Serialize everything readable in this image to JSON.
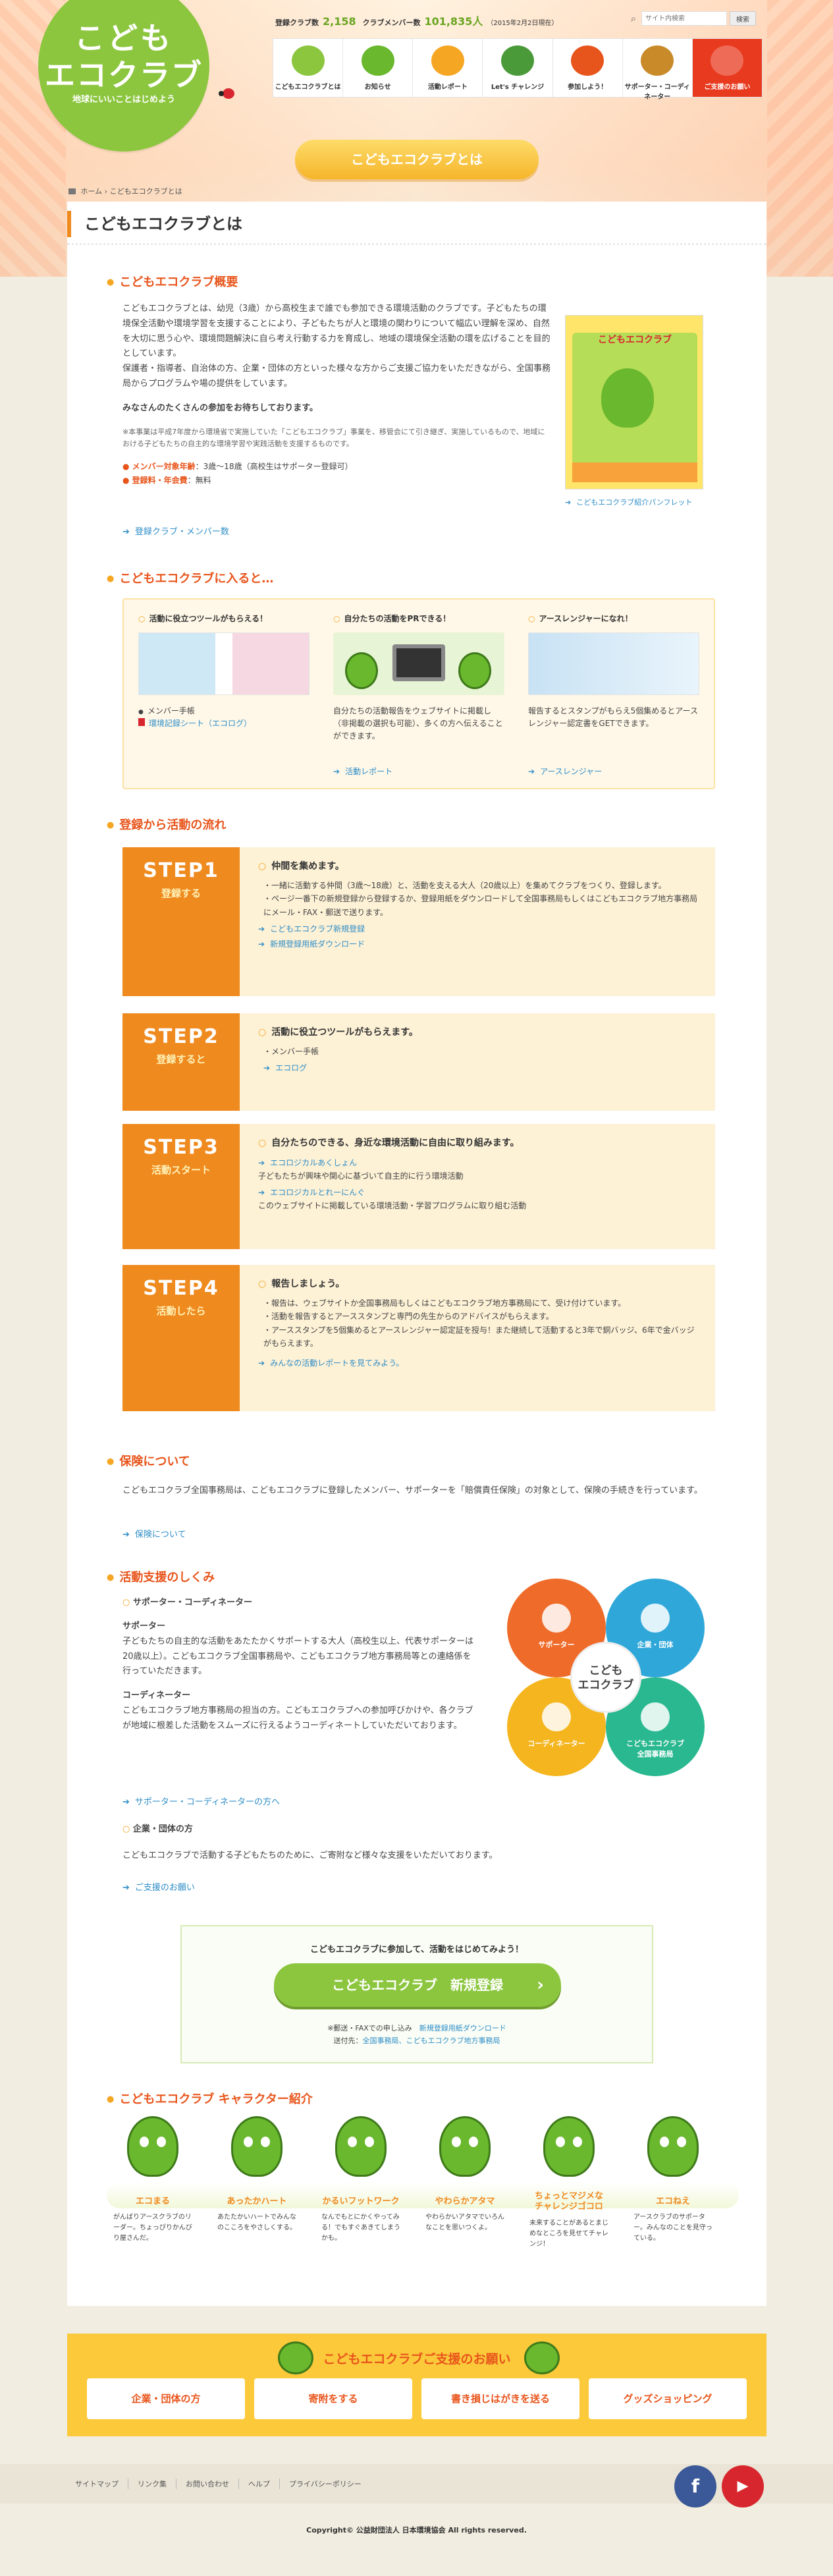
{
  "header": {
    "logo_line1": "こども",
    "logo_line2": "エコクラブ",
    "tagline": "地球にいいことはじめよう",
    "stats": {
      "clubs_label": "登録クラブ数",
      "clubs_value": "2,158",
      "members_label": "クラブメンバー数",
      "members_value": "101,835人",
      "date_note": "（2015年2月2日現在）"
    },
    "search": {
      "placeholder": "サイト内検索",
      "button": "検索"
    },
    "nav": [
      {
        "label": "こどもエコクラブとは",
        "icon": "leaf-icon",
        "color": "#8cc63f"
      },
      {
        "label": "お知らせ",
        "icon": "character-icon",
        "color": "#6ab82e"
      },
      {
        "label": "活動レポート",
        "icon": "pencil-icon",
        "color": "#f5a623"
      },
      {
        "label": "Let's チャレンジ",
        "icon": "board-icon",
        "color": "#4a9a3a"
      },
      {
        "label": "参加しよう！",
        "icon": "character-icon",
        "color": "#e8551c"
      },
      {
        "label": "サポーター・コーディネーター",
        "icon": "person-icon",
        "color": "#c98b2a"
      },
      {
        "label": "ご支援のお願い",
        "icon": "heart-icon",
        "color": "#ffffff"
      }
    ]
  },
  "page": {
    "title_pill": "こどもエコクラブとは",
    "breadcrumb_home": "ホーム",
    "breadcrumb_sep": "›",
    "breadcrumb_current": "こどもエコクラブとは",
    "heading": "こどもエコクラブとは"
  },
  "overview": {
    "heading": "こどもエコクラブ概要",
    "p1": "こどもエコクラブとは、幼児（3歳）から高校生まで誰でも参加できる環境活動のクラブです。子どもたちの環境保全活動や環境学習を支援することにより、子どもたちが人と環境の関わりについて幅広い理解を深め、自然を大切に思う心や、環境問題解決に自ら考え行動する力を育成し、地域の環境保全活動の環を広げることを目的としています。",
    "p2": "保護者・指導者、自治体の方、企業・団体の方といった様々な方からご支援ご協力をいただきながら、全国事務局からプログラムや場の提供をしています。",
    "p3": "みなさんのたくさんの参加をお待ちしております。",
    "note": "※本事業は平成7年度から環境省で実施していた「こどもエコクラブ」事業を、移管会にて引き継ぎ、実施しているもので、地域における子どもたちの自主的な環境学習や実践活動を支援するものです。",
    "members_label": "メンバー対象年齢",
    "members_value": "：3歳〜18歳（高校生はサポーター登録可）",
    "fee_label": "登録料・年会費",
    "fee_value": "：無料",
    "link": "登録クラブ・メンバー数",
    "pamphlet_title": "こどもエコクラブ",
    "pamphlet_link": "こどもエコクラブ紹介パンフレット"
  },
  "join": {
    "heading": "こどもエコクラブに入ると…",
    "cols": [
      {
        "title": "活動に役立つツールがもらえる！",
        "items": [
          "メンバー手帳",
          "環境記録シート（エコログ）"
        ]
      },
      {
        "title": "自分たちの活動をPRできる！",
        "text": "自分たちの活動報告をウェブサイトに掲載し（非掲載の選択も可能）、多くの方へ伝えることができます。",
        "link": "活動レポート"
      },
      {
        "title": "アースレンジャーになれ！",
        "text": "報告するとスタンプがもらえ5個集めるとアースレンジャー認定書をGETできます。",
        "link": "アースレンジャー"
      }
    ]
  },
  "flow": {
    "heading": "登録から活動の流れ",
    "steps": [
      {
        "step": "STEP1",
        "sub": "登録する",
        "head": "仲間を集めます。",
        "lines": [
          "一緒に活動する仲間（3歳〜18歳）と、活動を支える大人（20歳以上）を集めてクラブをつくり、登録します。",
          "ページ一番下の新規登録から登録するか、登録用紙をダウンロードして全国事務局もしくはこどもエコクラブ地方事務局にメール・FAX・郵送で送ります。"
        ],
        "links": [
          "こどもエコクラブ新規登録",
          "新規登録用紙ダウンロード"
        ]
      },
      {
        "step": "STEP2",
        "sub": "登録すると",
        "head": "活動に役立つツールがもらえます。",
        "lines": [
          "メンバー手帳"
        ],
        "links": [
          "エコログ"
        ]
      },
      {
        "step": "STEP3",
        "sub": "活動スタート",
        "head": "自分たちのできる、身近な環境活動に自由に取り組みます。",
        "lines": [
          "エコロジカルあくしょん",
          "子どもたちが興味や関心に基づいて自主的に行う環境活動",
          "エコロジカルとれーにんぐ",
          "このウェブサイトに掲載している環境活動・学習プログラムに取り組む活動"
        ],
        "links": []
      },
      {
        "step": "STEP4",
        "sub": "活動したら",
        "head": "報告しましょう。",
        "lines": [
          "報告は、ウェブサイトか全国事務局もしくはこどもエコクラブ地方事務局にて、受け付けています。",
          "活動を報告するとアーススタンプと専門の先生からのアドバイスがもらえます。",
          "アーススタンプを5個集めるとアースレンジャー認定証を授与！また継続して活動すると3年で銅バッジ、6年で金バッジがもらえます。"
        ],
        "links": [
          "みんなの活動レポートを見てみよう。"
        ]
      }
    ]
  },
  "insurance": {
    "heading": "保険について",
    "text": "こどもエコクラブ全国事務局は、こどもエコクラブに登録したメンバー、サポーターを「賠償責任保険」の対象として、保険の手続きを行っています。",
    "link": "保険について"
  },
  "support": {
    "heading": "活動支援のしくみ",
    "sub1": "サポーター・コーディネーター",
    "supporter_title": "サポーター",
    "supporter_text": "子どもたちの自主的な活動をあたたかくサポートする大人（高校生以上、代表サポーターは20歳以上）。こどもエコクラブ全国事務局や、こどもエコクラブ地方事務局等との連絡係を行っていただきます。",
    "coord_title": "コーディネーター",
    "coord_text": "こどもエコクラブ地方事務局の担当の方。こどもエコクラブへの参加呼びかけや、各クラブが地域に根差した活動をスムーズに行えるようコーディネートしていただいております。",
    "link1": "サポーター・コーディネーターの方へ",
    "sub2": "企業・団体の方",
    "company_text": "こどもエコクラブで活動する子どもたちのために、ご寄附など様々な支援をいただいております。",
    "link2": "ご支援のお願い",
    "center": "こども\nエコクラブ",
    "circles": [
      {
        "label": "サポーター",
        "color": "#ef6b2a"
      },
      {
        "label": "企業・団体",
        "color": "#2fa7d9"
      },
      {
        "label": "コーディネーター",
        "color": "#f5b51f"
      },
      {
        "label": "こどもエコクラブ\n全国事務局",
        "color": "#29b88f"
      }
    ]
  },
  "cta": {
    "lead": "こどもエコクラブに参加して、活動をはじめてみよう！",
    "button": "こどもエコクラブ　新規登録",
    "note1": "※郵送・FAXでの申し込み",
    "note1_link": "新規登録用紙ダウンロード",
    "note2_prefix": "送付先：",
    "note2_link": "全国事務局、こどもエコクラブ地方事務局"
  },
  "characters": {
    "heading": "こどもエコクラブ キャラクター紹介",
    "list": [
      {
        "name": "エコまる",
        "desc": "がんばりアースクラブのリーダー。ちょっぴりかんびり屋さんだ。"
      },
      {
        "name": "あったかハート",
        "desc": "あたたかいハートでみんなのこころをやさしくする。"
      },
      {
        "name": "かるいフットワーク",
        "desc": "なんでもとにかくやってみる！でもすぐあきてしまうかも。"
      },
      {
        "name": "やわらかアタマ",
        "desc": "やわらかいアタマでいろんなことを思いつくよ。"
      },
      {
        "name": "ちょっとマジメな\nチャレンジゴコロ",
        "desc": "未来することがあるとまじめなところを見せてチャレンジ！"
      },
      {
        "name": "エコねえ",
        "desc": "アースクラブのサポーター。みんなのことを見守っている。"
      }
    ]
  },
  "donate": {
    "heading": "こどもエコクラブご支援のお願い",
    "buttons": [
      "企業・団体の方",
      "寄附をする",
      "書き損じはがきを送る",
      "グッズショッピング"
    ]
  },
  "footer": {
    "links": [
      "サイトマップ",
      "リンク集",
      "お問い合わせ",
      "ヘルプ",
      "プライバシーポリシー"
    ],
    "facebook": "f",
    "youtube": "▶",
    "copyright": "Copyright© 公益財団法人 日本環境協会 All rights reserved."
  }
}
